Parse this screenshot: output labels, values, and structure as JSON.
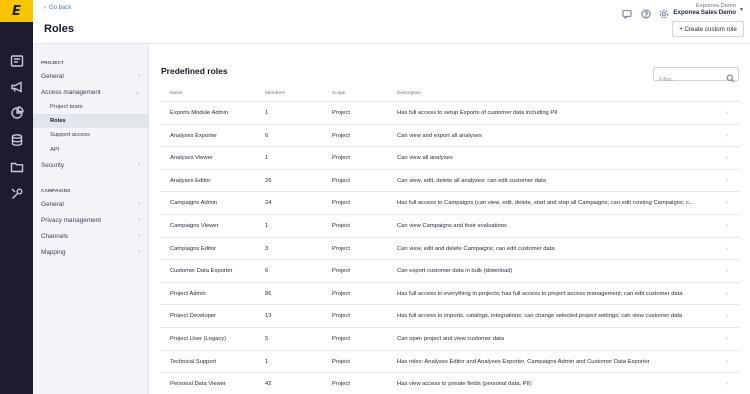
{
  "app": {
    "logo_text": "E",
    "accent": "#f7c600",
    "rail_bg": "#1c1c2e",
    "rail_icons": [
      "dashboard-icon",
      "megaphone-icon",
      "analytics-icon",
      "database-icon",
      "folder-icon",
      "tools-icon"
    ]
  },
  "header": {
    "back_label": "Go back",
    "title": "Roles",
    "org_line1": "Exponea Demo",
    "org_line2": "Exponea Sales Demo",
    "create_button": "+ Create custom role",
    "icons": [
      "chat-icon",
      "help-icon",
      "settings-icon"
    ]
  },
  "subnav": {
    "project_label": "PROJECT",
    "campaigns_label": "CAMPAIGNS",
    "general": "General",
    "access_management": "Access management",
    "project_team": "Project team",
    "roles": "Roles",
    "support_access": "Support access",
    "api": "API",
    "security": "Security",
    "campaigns_general": "General",
    "privacy_management": "Privacy management",
    "channels": "Channels",
    "mapping": "Mapping"
  },
  "main": {
    "section_title": "Predefined roles",
    "filter_placeholder": "Filter...",
    "columns": {
      "name": "Name",
      "members": "Members",
      "scope": "Scope",
      "description": "Description"
    },
    "roles": [
      {
        "name": "Exports Module Admin",
        "members": "1",
        "scope": "Project",
        "description": "Has full access to setup Exports of customer data including PII"
      },
      {
        "name": "Analyses Exporter",
        "members": "6",
        "scope": "Project",
        "description": "Can view and export all analyses"
      },
      {
        "name": "Analyses Viewer",
        "members": "1",
        "scope": "Project",
        "description": "Can view all analyses"
      },
      {
        "name": "Analyses Editor",
        "members": "26",
        "scope": "Project",
        "description": "Can view, edit, delete all analyses; can edit customer data"
      },
      {
        "name": "Campaigns Admin",
        "members": "24",
        "scope": "Project",
        "description": "Has full access to Campaigns (can view, edit, delete, start and stop all Campaigns; can edit running Campaigns; c..."
      },
      {
        "name": "Campaigns Viewer",
        "members": "1",
        "scope": "Project",
        "description": "Can view Campaigns and their evaluations"
      },
      {
        "name": "Campaigns Editor",
        "members": "3",
        "scope": "Project",
        "description": "Can view, edit and delete Campaigns; can edit customer data"
      },
      {
        "name": "Customer Data Exporter",
        "members": "6",
        "scope": "Project",
        "description": "Can export customer data in bulk (download)"
      },
      {
        "name": "Project Admin",
        "members": "86",
        "scope": "Project",
        "description": "Has full access to everything in projects; has full access to project access management; can edit customer data"
      },
      {
        "name": "Project Developer",
        "members": "13",
        "scope": "Project",
        "description": "Has full access to imports, catalogs, integrations; can change selected project settings; can view customer data"
      },
      {
        "name": "Project User (Legacy)",
        "members": "5",
        "scope": "Project",
        "description": "Can open project and view customer data"
      },
      {
        "name": "Technical Support",
        "members": "1",
        "scope": "Project",
        "description": "Has roles: Analyses Editor and Analyses Exporter, Campaigns Admin and Customer Data Exporter"
      },
      {
        "name": "Personal Data Viewer",
        "members": "42",
        "scope": "Project",
        "description": "Has view access to private fields (personal data, PII)"
      }
    ]
  }
}
